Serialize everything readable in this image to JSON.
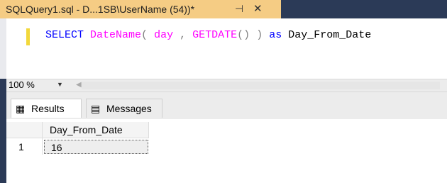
{
  "tab": {
    "title": "SQLQuery1.sql - D...1SB\\UserName (54))*",
    "pin_glyph": "⊣",
    "close_glyph": "✕"
  },
  "editor": {
    "code": {
      "select": "SELECT",
      "fn1": "DateName",
      "open1": "(",
      "arg": "day",
      "comma": ",",
      "fn2": "GETDATE",
      "parens": "()",
      "close1": ")",
      "as": "as",
      "alias": "Day_From_Date"
    }
  },
  "zoombar": {
    "zoom": "100 %"
  },
  "results": {
    "tabs": [
      {
        "label": "Results",
        "icon": "grid-icon"
      },
      {
        "label": "Messages",
        "icon": "messages-icon"
      }
    ],
    "columns": [
      "Day_From_Date"
    ],
    "rows": [
      {
        "num": "1",
        "cells": [
          "16"
        ]
      }
    ]
  }
}
